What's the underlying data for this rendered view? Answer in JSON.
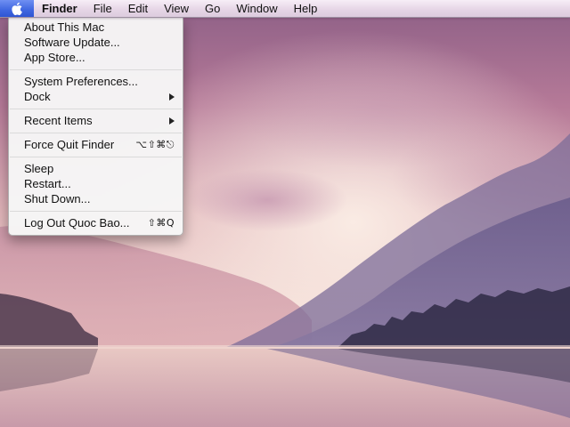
{
  "menubar": {
    "apple_icon": "apple-logo-icon",
    "app_name": "Finder",
    "menus": [
      "File",
      "Edit",
      "View",
      "Go",
      "Window",
      "Help"
    ]
  },
  "apple_menu": {
    "groups": [
      [
        {
          "label": "About This Mac"
        },
        {
          "label": "Software Update..."
        },
        {
          "label": "App Store..."
        }
      ],
      [
        {
          "label": "System Preferences..."
        },
        {
          "label": "Dock",
          "submenu": true
        }
      ],
      [
        {
          "label": "Recent Items",
          "submenu": true
        }
      ],
      [
        {
          "label": "Force Quit Finder",
          "shortcut": "⌥⇧⌘⎋"
        }
      ],
      [
        {
          "label": "Sleep"
        },
        {
          "label": "Restart..."
        },
        {
          "label": "Shut Down..."
        }
      ],
      [
        {
          "label": "Log Out Quoc Bao...",
          "shortcut": "⇧⌘Q"
        }
      ]
    ]
  },
  "colors": {
    "menu_highlight": "#3f66e0",
    "menubar_bg": "#e6d6e6",
    "dropdown_bg": "#f6f6f6"
  }
}
